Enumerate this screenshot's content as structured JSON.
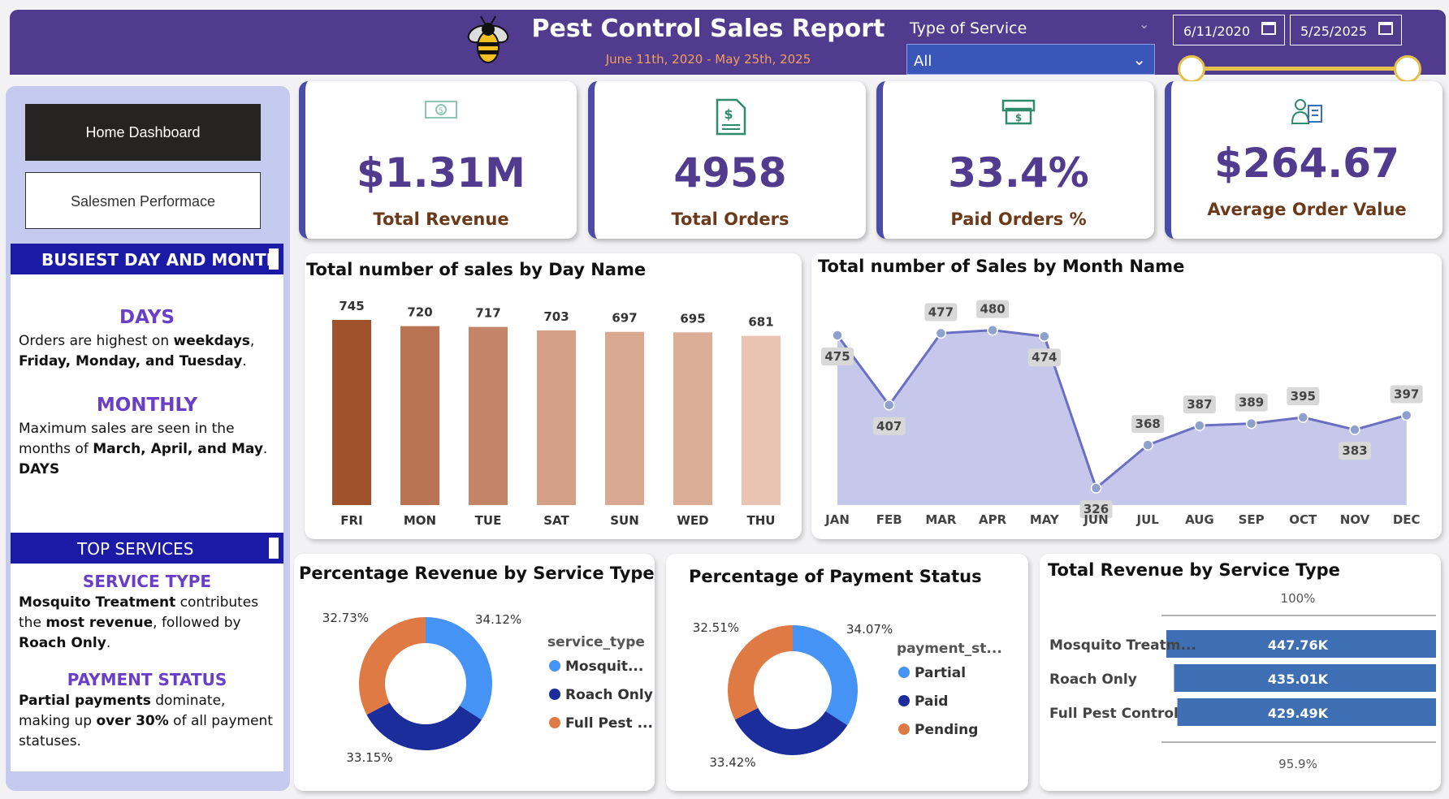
{
  "header": {
    "title": "Pest Control Sales Report",
    "subtitle": "June 11th, 2020 - May 25th, 2025",
    "service_filter_label": "Type of Service",
    "service_filter_value": "All",
    "start_date": "6/11/2020",
    "end_date": "5/25/2025"
  },
  "nav": {
    "home_label": "Home Dashboard",
    "salesmen_label": "Salesmen Performace"
  },
  "busiest": {
    "bar_label": "BUSIEST DAY AND MONTH",
    "days_head": "DAYS",
    "days_text_pre": "Orders are highest on ",
    "days_bold1": "weekdays",
    "days_text_mid": ", ",
    "days_bold2": "Friday, Monday, and Tuesday",
    "days_text_end": ".",
    "monthly_head": "MONTHLY",
    "monthly_text_pre": "Maximum sales are seen in the months of ",
    "monthly_bold": "March, April, and May",
    "monthly_text_end": ".",
    "monthly_trailer": "DAYS"
  },
  "top_services": {
    "bar_label": "TOP SERVICES",
    "service_head": "SERVICE TYPE",
    "service_bold1": "Mosquito Treatment",
    "service_text_mid": " contributes the ",
    "service_bold2": "most revenue",
    "service_text_mid2": ", followed by ",
    "service_bold3": "Roach Only",
    "service_text_end": ".",
    "payment_head": "PAYMENT STATUS",
    "payment_bold1": "Partial payments",
    "payment_text_mid": " dominate, making up ",
    "payment_bold2": "over 30%",
    "payment_text_end": " of all payment statuses."
  },
  "kpis": [
    {
      "value": "$1.31M",
      "label": "Total Revenue",
      "icon": "cash-icon"
    },
    {
      "value": "4958",
      "label": "Total Orders",
      "icon": "invoice-icon"
    },
    {
      "value": "33.4%",
      "label": "Paid Orders %",
      "icon": "payment-icon"
    },
    {
      "value": "$264.67",
      "label": "Average Order Value",
      "icon": "order-value-icon"
    }
  ],
  "chart_titles": {
    "day": "Total number of sales by Day Name",
    "month": "Total number of Sales by Month Name",
    "service_pct": "Percentage Revenue by Service Type",
    "payment_pct": "Percentage of Payment Status",
    "service_rev": "Total Revenue by Service Type"
  },
  "chart_data": [
    {
      "type": "bar",
      "title": "Total number of sales by Day Name",
      "categories": [
        "FRI",
        "MON",
        "TUE",
        "SAT",
        "SUN",
        "WED",
        "THU"
      ],
      "values": [
        745,
        720,
        717,
        703,
        697,
        695,
        681
      ],
      "colors": [
        "#a0522d",
        "#b97353",
        "#c48468",
        "#d4a088",
        "#d9a890",
        "#dcae98",
        "#eac4b2"
      ]
    },
    {
      "type": "area",
      "title": "Total number of Sales by Month Name",
      "categories": [
        "JAN",
        "FEB",
        "MAR",
        "APR",
        "MAY",
        "JUN",
        "JUL",
        "AUG",
        "SEP",
        "OCT",
        "NOV",
        "DEC"
      ],
      "values": [
        475,
        407,
        477,
        480,
        474,
        326,
        368,
        387,
        389,
        395,
        383,
        397
      ],
      "ylim": [
        300,
        490
      ],
      "color": "#6b6fc4"
    },
    {
      "type": "pie",
      "title": "Percentage Revenue by Service Type",
      "legend_title": "service_type",
      "labels": [
        "Mosquit...",
        "Roach Only",
        "Full Pest ..."
      ],
      "values": [
        34.12,
        33.15,
        32.73
      ],
      "value_labels": [
        "34.12%",
        "33.15%",
        "32.73%"
      ],
      "colors": [
        "#4593f4",
        "#1a2d9a",
        "#e07a44"
      ]
    },
    {
      "type": "pie",
      "title": "Percentage of Payment Status",
      "legend_title": "payment_st...",
      "labels": [
        "Partial",
        "Paid",
        "Pending"
      ],
      "values": [
        34.07,
        33.42,
        32.51
      ],
      "value_labels": [
        "34.07%",
        "33.42%",
        "32.51%"
      ],
      "colors": [
        "#4593f4",
        "#1a2d9a",
        "#e07a44"
      ]
    },
    {
      "type": "bar",
      "orientation": "horizontal",
      "title": "Total Revenue by Service Type",
      "categories": [
        "Mosquito Treatm...",
        "Roach Only",
        "Full Pest Control"
      ],
      "values": [
        447.76,
        435.01,
        429.49
      ],
      "value_labels": [
        "447.76K",
        "435.01K",
        "429.49K"
      ],
      "top_axis_label": "100%",
      "bottom_axis_label": "95.9%",
      "color": "#3e6fb5"
    }
  ]
}
